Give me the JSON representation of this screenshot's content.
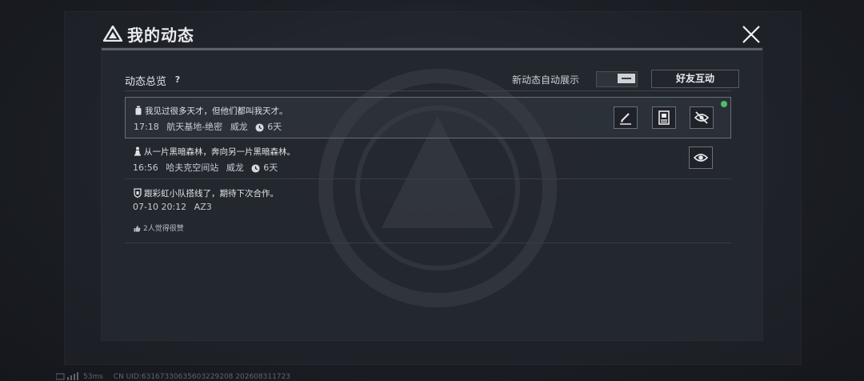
{
  "title": "我的动态",
  "section": {
    "title": "动态总览",
    "help": "?"
  },
  "auto_show": {
    "label": "新动态自动展示"
  },
  "friend_button": "好友互动",
  "posts": [
    {
      "text": "我见过很多天才，但他们都叫我天才。",
      "time": "17:18",
      "location": "航天基地-绝密",
      "name": "威龙",
      "duration": "6天"
    },
    {
      "text": "从一片黑暗森林，奔向另一片黑暗森林。",
      "time": "16:56",
      "location": "哈夫克空间站",
      "name": "威龙",
      "duration": "6天"
    },
    {
      "text": "跟彩虹小队搭线了，期待下次合作。",
      "time": "07-10 20:12",
      "location": "AZ3",
      "likes": "2人觉得很赞"
    }
  ],
  "footer": {
    "ping": "53ms",
    "uid": "CN UID:6316733063560322920​8 202608311723"
  },
  "colors": {
    "accent_green": "#4cc066",
    "panel": "#24282f"
  }
}
